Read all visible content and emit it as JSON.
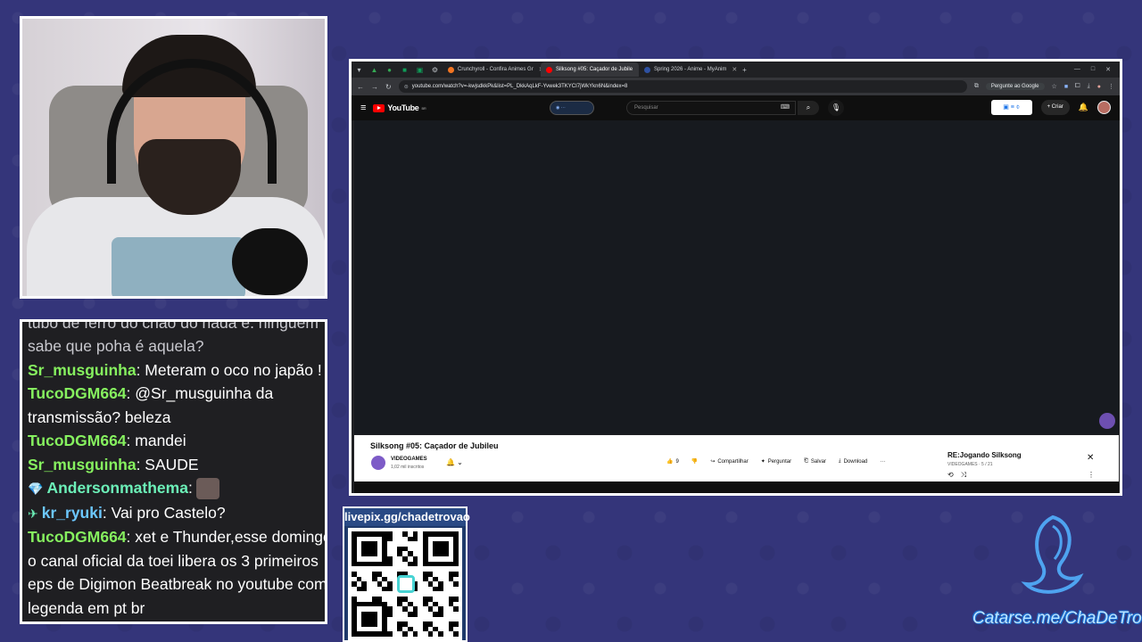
{
  "browser": {
    "tabs": [
      {
        "label": "Crunchyroll - Confira Animes Gr",
        "color": "#f47521",
        "active": false
      },
      {
        "label": "Silksong #05: Caçador de Jubile",
        "color": "#ff0000",
        "active": true
      },
      {
        "label": "Spring 2026 - Anime - MyAnim",
        "color": "#2e51a2",
        "active": false
      }
    ],
    "url": "youtube.com/watch?v=-kwjsdkkPk&list=PL_DkkAqLkF-Yvwek3TKYCI7jWkYkn6N&index=8",
    "ask_google": "Pergunte ao Google"
  },
  "youtube": {
    "logo_text": "YouTube",
    "logo_sup": "BR",
    "search_placeholder": "Pesquisar",
    "create_label": "Criar",
    "video_title": "Silksong #05: Caçador de Jubileu",
    "channel_name": "VIDEOGAMES",
    "channel_subs": "1,02 mil inscritos",
    "likes": "9",
    "share_label": "Compartilhar",
    "ask_label": "Perguntar",
    "save_label": "Salvar",
    "download_label": "Download",
    "playlist_title": "RE:Jogando Silksong",
    "playlist_sub": "VIDEOGAMES · 5 / 21"
  },
  "chat": {
    "messages": [
      {
        "user": "",
        "text": "tubo de ferro do chão do nada e. ninguém",
        "color": "",
        "faded": true
      },
      {
        "user": "",
        "text": "sabe que poha é aquela?",
        "color": "",
        "faded": true
      },
      {
        "user": "Sr_musguinha",
        "text": ": Meteram o oco no japão !",
        "color": "green"
      },
      {
        "user": "TucoDGM664",
        "text": ": @Sr_musguinha da",
        "color": "green"
      },
      {
        "user": "",
        "text": "transmissão? beleza",
        "color": ""
      },
      {
        "user": "TucoDGM664",
        "text": ": mandei",
        "color": "green"
      },
      {
        "user": "Sr_musguinha",
        "text": ": SAUDE",
        "color": "green"
      },
      {
        "user": "Andersonmathema",
        "text": ":",
        "color": "teal",
        "badge": "💎",
        "emote": true
      },
      {
        "user": "kr_ryuki",
        "text": ": Vai pro Castelo?",
        "color": "blue",
        "badge": "✈"
      },
      {
        "user": "TucoDGM664",
        "text": ": xet e Thunder,esse domingo",
        "color": "green"
      },
      {
        "user": "",
        "text": "o canal oficial da toei libera os 3 primeiros",
        "color": ""
      },
      {
        "user": "",
        "text": "eps de Digimon Beatbreak no youtube com",
        "color": ""
      },
      {
        "user": "",
        "text": "legenda em pt br",
        "color": ""
      }
    ]
  },
  "overlay": {
    "qr_label": "livepix.gg/chadetrovao",
    "catarse_text": "Catarse.me/ChaDeTrovao"
  }
}
